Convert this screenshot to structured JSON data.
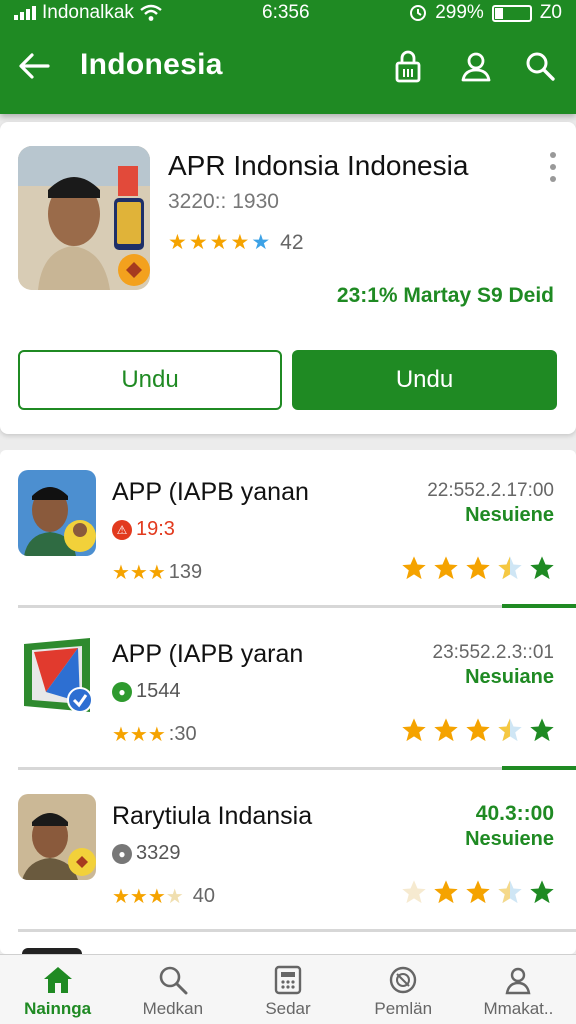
{
  "status_bar": {
    "carrier": "Indonalkak",
    "time": "6:356",
    "battery": "299%",
    "network": "Z0"
  },
  "app_bar": {
    "title": "Indonesia",
    "icons": [
      "back-arrow-icon",
      "lock-icon",
      "profile-icon",
      "search-icon"
    ]
  },
  "featured": {
    "title": "APR Indonsia Indonesia",
    "subtitle": "3220:: 1930",
    "rating_count": "42",
    "rating_stars": 4.5,
    "note": "23:1% Martay  S9 Deid",
    "button_outline": "Undu",
    "button_solid": "Undu"
  },
  "items": [
    {
      "title": "APP (IAPB yanan",
      "meta": "19:3",
      "meta_color": "#e23a1e",
      "count": "139",
      "time": "22:552.2.17:00",
      "status": "Nesuiene",
      "stars_level": 3.5
    },
    {
      "title": "APP (IAPB yaran",
      "meta": "1544",
      "meta_color": "#2e9a2e",
      "count": ":30",
      "time": "23:552.2.3::01",
      "status": "Nesuiane",
      "stars_level": 3.5
    },
    {
      "title": "Rarytiula Indansia",
      "meta": "3329",
      "meta_color": "#777777",
      "count": "40",
      "time": "40.3::00",
      "status": "Nesuiene",
      "stars_level": 3
    }
  ],
  "bottom_nav": [
    {
      "label": "Nainnga",
      "icon": "home-icon",
      "active": true
    },
    {
      "label": "Medkan",
      "icon": "search-icon",
      "active": false
    },
    {
      "label": "Sedar",
      "icon": "calculator-icon",
      "active": false
    },
    {
      "label": "Pemlän",
      "icon": "compass-icon",
      "active": false
    },
    {
      "label": "Mmakat..",
      "icon": "person-icon",
      "active": false
    }
  ],
  "colors": {
    "primary": "#1f8a23",
    "star": "#f5a300",
    "star_blue": "#3da2e6"
  }
}
